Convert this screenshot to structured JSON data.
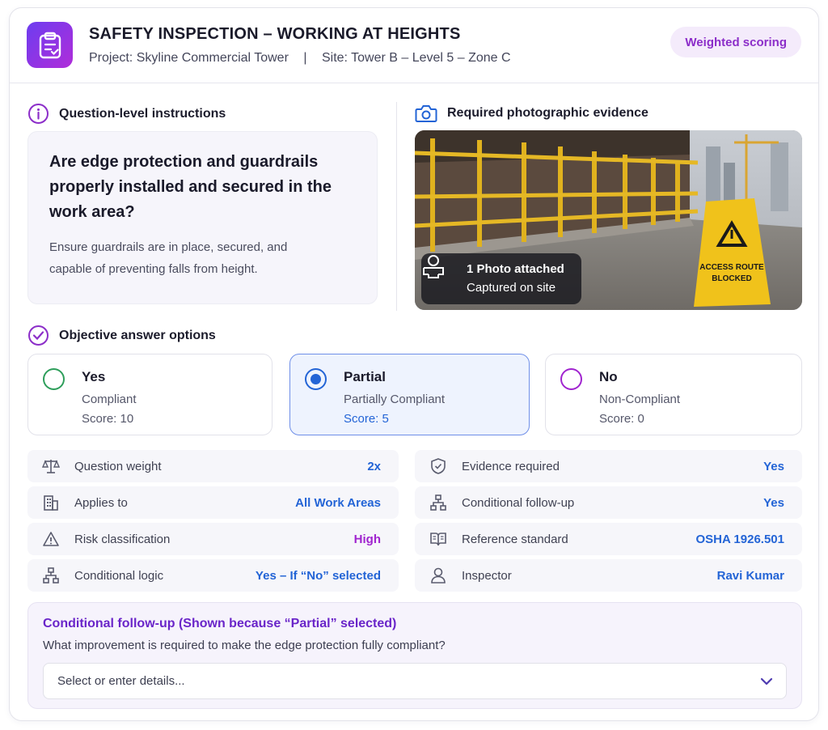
{
  "header": {
    "title": "SAFETY INSPECTION – WORKING AT HEIGHTS",
    "project_label": "Project:",
    "project_value": "Skyline Commercial Tower",
    "separator": "|",
    "site_label": "Site:",
    "site_value": "Tower B – Level 5 – Zone C",
    "badge": "Weighted scoring"
  },
  "instructions": {
    "heading": "Question-level instructions",
    "question": "Are edge protection and guardrails properly installed and secured in the work area?",
    "description": "Ensure guardrails are in place, secured, and capable of preventing falls from height."
  },
  "evidence": {
    "heading": "Required photographic evidence",
    "chip_title": "1 Photo attached",
    "chip_sub": "Captured on site",
    "sign_line1": "ACCESS ROUTE",
    "sign_line2": "BLOCKED"
  },
  "options": {
    "heading": "Objective answer options",
    "items": [
      {
        "label": "Yes",
        "sub": "Compliant",
        "score": "Score: 10",
        "color": "#2e9e5b"
      },
      {
        "label": "Partial",
        "sub": "Partially Compliant",
        "score": "Score: 5",
        "color": "#2364d6"
      },
      {
        "label": "No",
        "sub": "Non-Compliant",
        "score": "Score: 0",
        "color": "#a024cf"
      }
    ],
    "selected": "Partial"
  },
  "info_left": [
    {
      "key": "Question weight",
      "value": "2x",
      "icon": "scale-icon"
    },
    {
      "key": "Applies to",
      "value": "All Work Areas",
      "icon": "building-icon"
    },
    {
      "key": "Risk classification",
      "value": "High",
      "icon": "warning-icon"
    },
    {
      "key": "Conditional logic",
      "value": "Yes – If “No” selected",
      "icon": "flow-icon"
    }
  ],
  "info_right": [
    {
      "key": "Evidence required",
      "value": "Yes",
      "icon": "shield-check-icon"
    },
    {
      "key": "Conditional follow-up",
      "value": "Yes",
      "icon": "flow-icon"
    },
    {
      "key": "Reference standard",
      "value": "OSHA 1926.501",
      "icon": "book-icon"
    },
    {
      "key": "Inspector",
      "value": "Ravi Kumar",
      "icon": "user-icon"
    }
  ],
  "followup": {
    "title": "Conditional follow-up (Shown because “Partial” selected)",
    "description": "What improvement is required to make the edge protection fully compliant?",
    "placeholder": "Select or enter details..."
  },
  "colors": {
    "accent_purple": "#8c2ec9",
    "accent_blue": "#2364d6",
    "risk_high": "#a024cf"
  }
}
